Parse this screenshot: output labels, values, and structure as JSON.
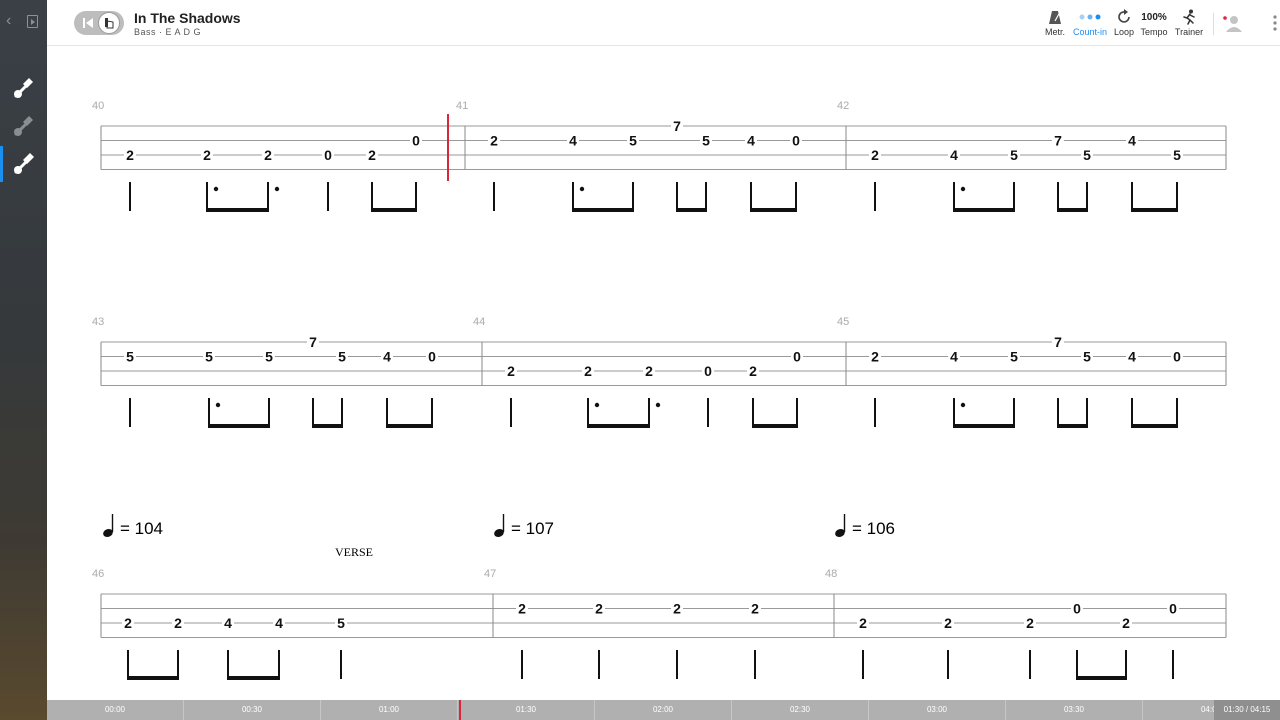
{
  "header": {
    "song_title": "In The Shadows",
    "track_info": "Bass · E A D G"
  },
  "toolbar": {
    "metronome_label": "Metr.",
    "countin_label": "Count-in",
    "loop_label": "Loop",
    "tempo_value": "100%",
    "tempo_label": "Tempo",
    "trainer_label": "Trainer"
  },
  "sidebar": {
    "tracks": [
      {
        "icon": "guitar-icon",
        "active": false
      },
      {
        "icon": "guitar-icon",
        "active": false
      },
      {
        "icon": "bass-guitar-icon",
        "active": true
      }
    ]
  },
  "score": {
    "bars": [
      {
        "number": "40",
        "notes": [
          {
            "fret": "2",
            "string": "A"
          },
          {
            "fret": "2",
            "string": "A"
          },
          {
            "fret": "2",
            "string": "A"
          },
          {
            "fret": "0",
            "string": "A"
          },
          {
            "fret": "2",
            "string": "A"
          },
          {
            "fret": "0",
            "string": "D"
          }
        ]
      },
      {
        "number": "41",
        "notes": [
          {
            "fret": "2",
            "string": "D"
          },
          {
            "fret": "4",
            "string": "D"
          },
          {
            "fret": "5",
            "string": "D"
          },
          {
            "fret": "7",
            "string": "G"
          },
          {
            "fret": "5",
            "string": "D"
          },
          {
            "fret": "4",
            "string": "D"
          },
          {
            "fret": "0",
            "string": "D"
          }
        ]
      },
      {
        "number": "42",
        "notes": [
          {
            "fret": "2",
            "string": "A"
          },
          {
            "fret": "4",
            "string": "A"
          },
          {
            "fret": "5",
            "string": "A"
          },
          {
            "fret": "7",
            "string": "D"
          },
          {
            "fret": "5",
            "string": "A"
          },
          {
            "fret": "4",
            "string": "D"
          },
          {
            "fret": "5",
            "string": "A"
          }
        ]
      },
      {
        "number": "43",
        "notes": [
          {
            "fret": "5",
            "string": "D"
          },
          {
            "fret": "5",
            "string": "D"
          },
          {
            "fret": "5",
            "string": "D"
          },
          {
            "fret": "7",
            "string": "G"
          },
          {
            "fret": "5",
            "string": "D"
          },
          {
            "fret": "4",
            "string": "D"
          },
          {
            "fret": "0",
            "string": "D"
          }
        ]
      },
      {
        "number": "44",
        "notes": [
          {
            "fret": "2",
            "string": "A"
          },
          {
            "fret": "2",
            "string": "A"
          },
          {
            "fret": "2",
            "string": "A"
          },
          {
            "fret": "0",
            "string": "A"
          },
          {
            "fret": "2",
            "string": "A"
          },
          {
            "fret": "0",
            "string": "D"
          }
        ]
      },
      {
        "number": "45",
        "notes": [
          {
            "fret": "2",
            "string": "D"
          },
          {
            "fret": "4",
            "string": "D"
          },
          {
            "fret": "5",
            "string": "D"
          },
          {
            "fret": "7",
            "string": "G"
          },
          {
            "fret": "5",
            "string": "D"
          },
          {
            "fret": "4",
            "string": "D"
          },
          {
            "fret": "0",
            "string": "D"
          }
        ]
      },
      {
        "number": "46",
        "notes": [
          {
            "fret": "2",
            "string": "A"
          },
          {
            "fret": "2",
            "string": "A"
          },
          {
            "fret": "4",
            "string": "A"
          },
          {
            "fret": "4",
            "string": "A"
          },
          {
            "fret": "5",
            "string": "A"
          }
        ]
      },
      {
        "number": "47",
        "notes": [
          {
            "fret": "2",
            "string": "D"
          },
          {
            "fret": "2",
            "string": "D"
          },
          {
            "fret": "2",
            "string": "D"
          },
          {
            "fret": "2",
            "string": "D"
          }
        ]
      },
      {
        "number": "48",
        "notes": [
          {
            "fret": "2",
            "string": "A"
          },
          {
            "fret": "2",
            "string": "A"
          },
          {
            "fret": "2",
            "string": "A"
          },
          {
            "fret": "0",
            "string": "D"
          },
          {
            "fret": "2",
            "string": "A"
          },
          {
            "fret": "0",
            "string": "D"
          }
        ]
      }
    ],
    "tempos": [
      "= 104",
      "= 107",
      "= 106"
    ],
    "section_label": "VERSE"
  },
  "timeline": {
    "ticks": [
      "00:00",
      "00:30",
      "01:00",
      "01:30",
      "02:00",
      "02:30",
      "03:00",
      "03:30",
      "04:00"
    ],
    "position": "01:30 / 04:15",
    "progress_fraction": 0.353
  },
  "colors": {
    "accent": "#1a8ff0",
    "cursor": "#d9263a",
    "timeline_bg": "#b0b0b0"
  }
}
